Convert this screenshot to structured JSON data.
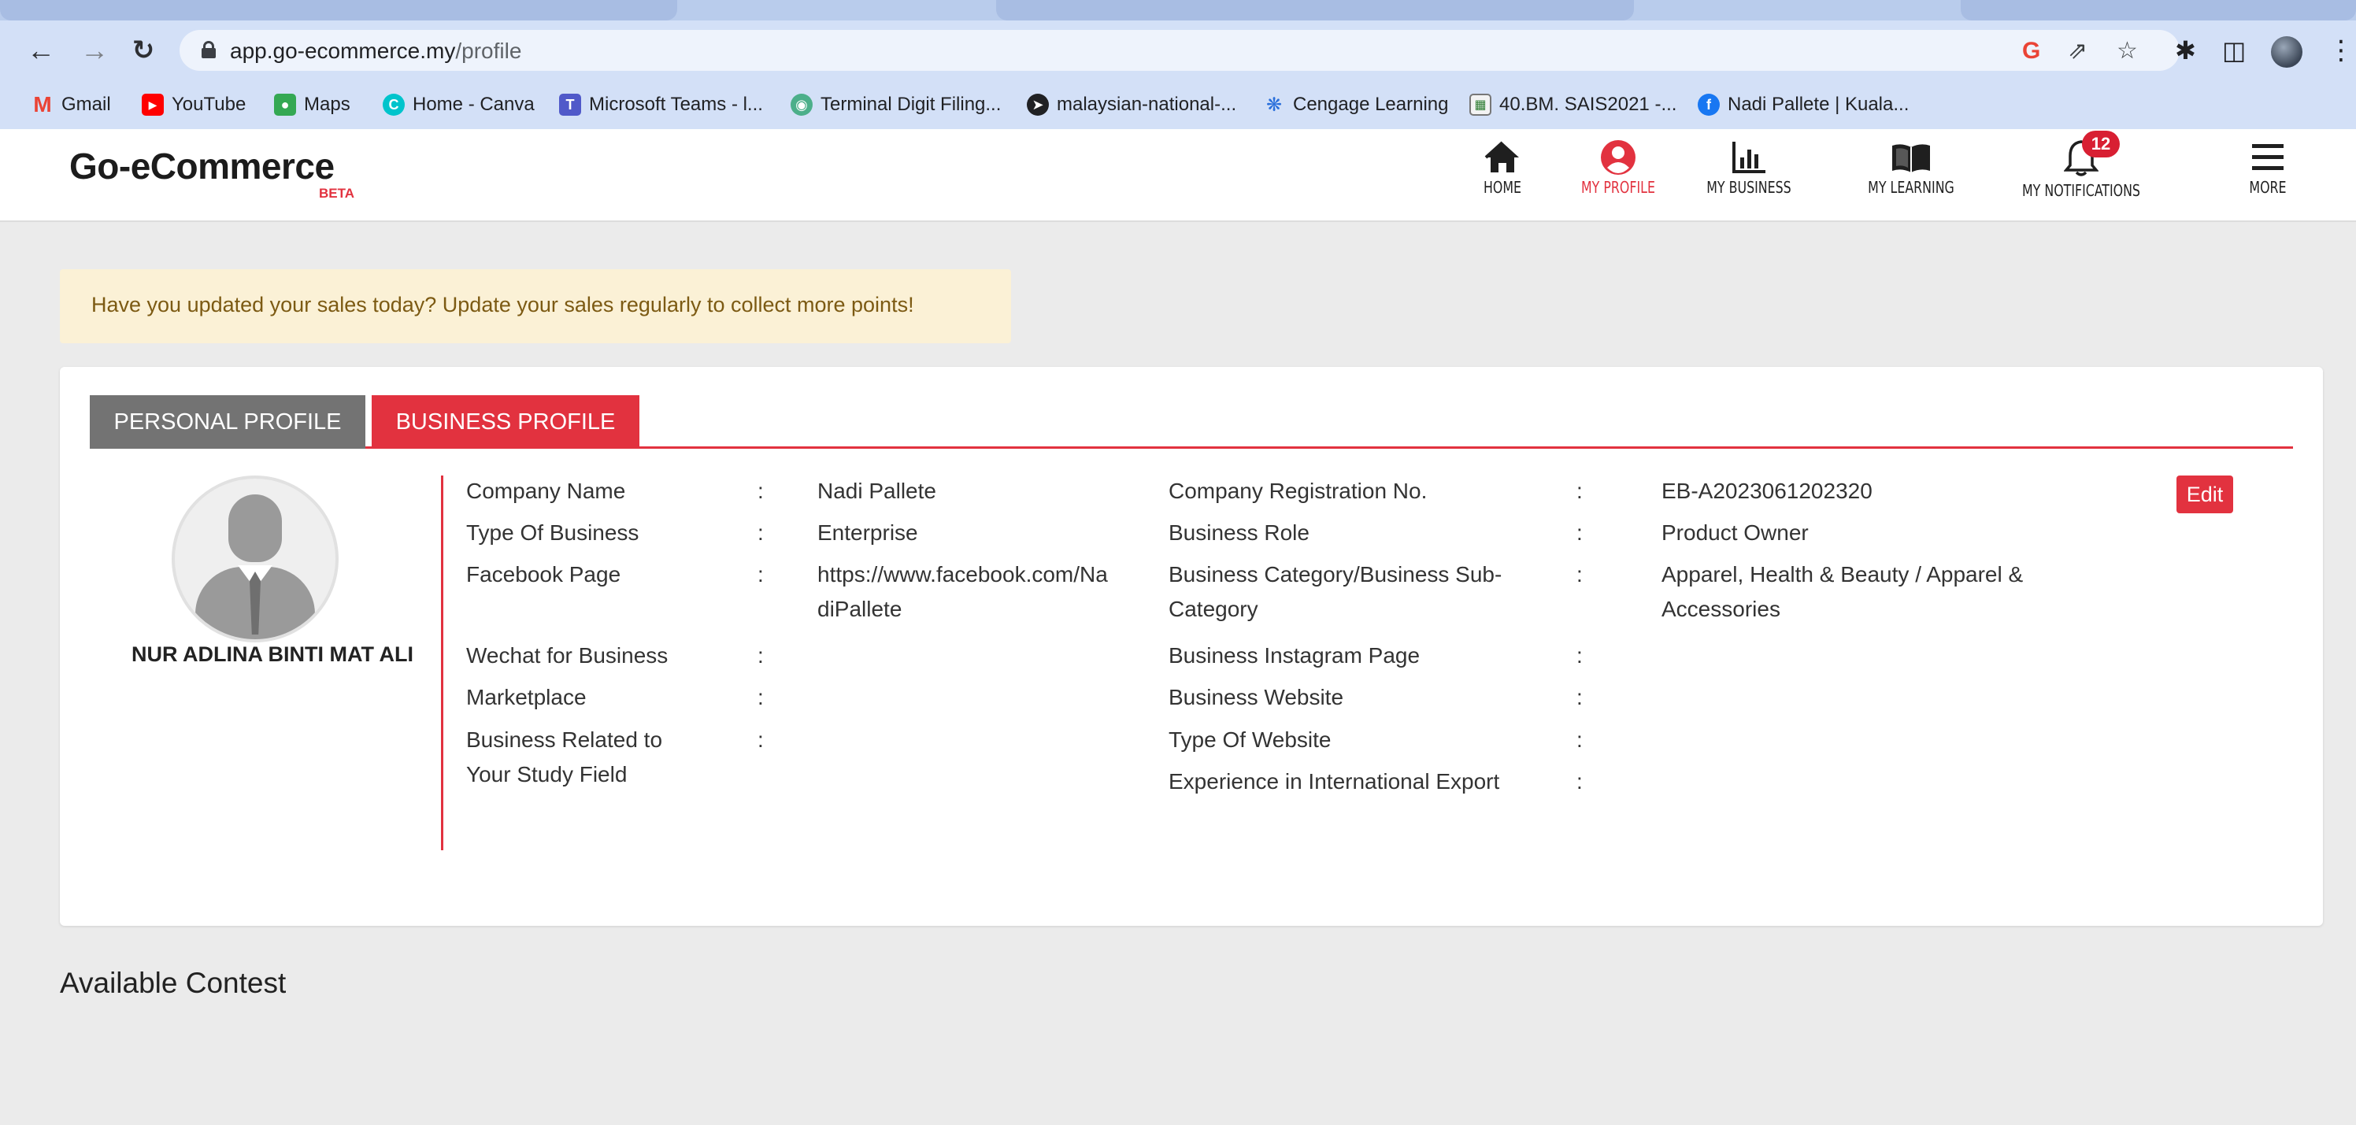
{
  "browser": {
    "url_host": "app.go-ecommerce.my",
    "url_path": "/profile",
    "bookmarks": [
      {
        "label": "Gmail"
      },
      {
        "label": "YouTube"
      },
      {
        "label": "Maps"
      },
      {
        "label": "Home - Canva"
      },
      {
        "label": "Microsoft Teams - l..."
      },
      {
        "label": "Terminal Digit Filing..."
      },
      {
        "label": "malaysian-national-..."
      },
      {
        "label": "Cengage Learning"
      },
      {
        "label": "40.BM. SAIS2021 -..."
      },
      {
        "label": "Nadi Pallete | Kuala..."
      }
    ]
  },
  "app": {
    "logo": "Go-eCommerce",
    "logo_badge": "BETA",
    "nav": [
      {
        "label": "HOME",
        "icon": "home-icon"
      },
      {
        "label": "MY PROFILE",
        "icon": "user-circle-icon",
        "active": true
      },
      {
        "label": "MY BUSINESS",
        "icon": "bar-chart-icon"
      },
      {
        "label": "MY LEARNING",
        "icon": "book-icon"
      },
      {
        "label": "MY NOTIFICATIONS",
        "icon": "bell-icon",
        "badge": "12"
      },
      {
        "label": "MORE",
        "icon": "hamburger-icon"
      }
    ],
    "accent_color": "#e2323f"
  },
  "alert": {
    "text": "Have you updated your sales today? Update your sales regularly to collect more points!"
  },
  "profile": {
    "tabs": [
      "PERSONAL PROFILE",
      "BUSINESS PROFILE"
    ],
    "active_tab": "BUSINESS PROFILE",
    "user_name": "NUR ADLINA BINTI MAT ALI",
    "edit_label": "Edit",
    "colon": ":",
    "left_fields": [
      {
        "label": "Company Name",
        "value": "Nadi Pallete"
      },
      {
        "label": "Type Of Business",
        "value": "Enterprise"
      },
      {
        "label": "Facebook Page",
        "value_line1": "https://www.facebook.com/Na",
        "value_line2": "diPallete"
      },
      {
        "label": "Wechat for Business",
        "value": ""
      },
      {
        "label": "Marketplace",
        "value": ""
      },
      {
        "label_line1": "Business Related to",
        "label_line2": "Your Study Field",
        "value": ""
      }
    ],
    "right_fields": [
      {
        "label": "Company Registration No.",
        "value": "EB-A2023061202320"
      },
      {
        "label": "Business Role",
        "value": "Product Owner"
      },
      {
        "label_line1": "Business Category/Business Sub-",
        "label_line2": "Category",
        "value_line1": "Apparel, Health & Beauty / Apparel &",
        "value_line2": "Accessories"
      },
      {
        "label": "Business Instagram Page",
        "value": ""
      },
      {
        "label": "Business Website",
        "value": ""
      },
      {
        "label": "Type Of Website",
        "value": ""
      },
      {
        "label": "Experience in International Export",
        "value": ""
      }
    ]
  },
  "contest": {
    "heading": "Available Contest"
  }
}
